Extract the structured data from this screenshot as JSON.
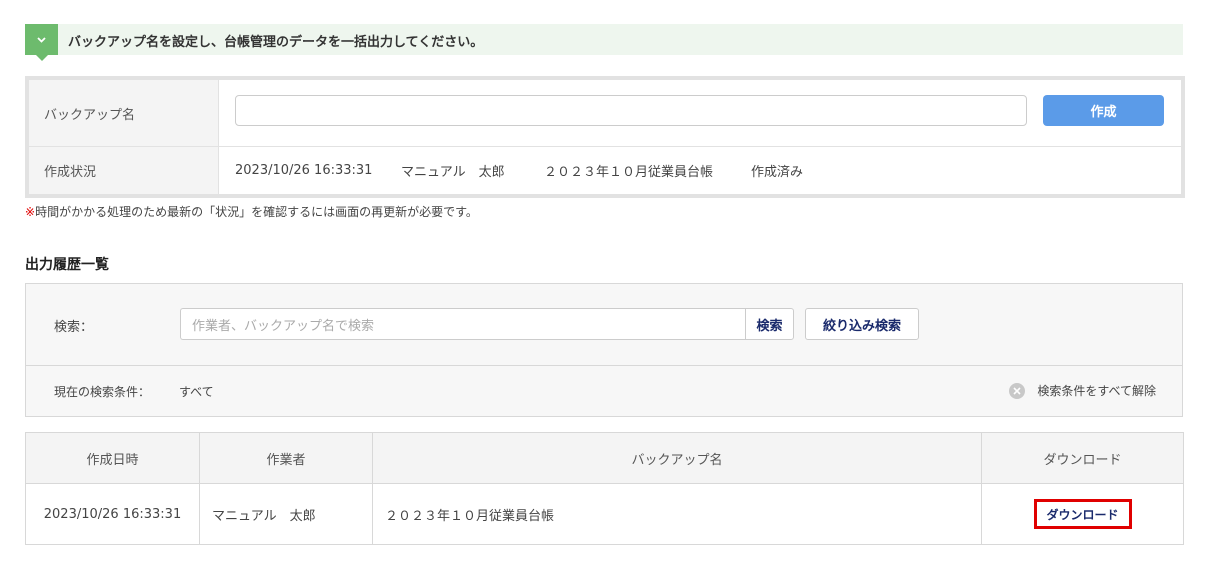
{
  "banner": {
    "text": "バックアップ名を設定し、台帳管理のデータを一括出力してください。",
    "icon": "chevron-down-icon"
  },
  "form": {
    "name_label": "バックアップ名",
    "name_value": "",
    "create_label": "作成",
    "status_label": "作成状況",
    "status": {
      "datetime": "2023/10/26 16:33:31",
      "user": "マニュアル　太郎",
      "backup_name": "２０２３年１０月従業員台帳",
      "state": "作成済み"
    }
  },
  "note": {
    "mark": "※",
    "text": "時間がかかる処理のため最新の「状況」を確認するには画面の再更新が必要です。"
  },
  "history": {
    "title": "出力履歴一覧",
    "search": {
      "label": "検索：",
      "placeholder": "作業者、バックアップ名で検索",
      "search_button": "検索",
      "filter_button": "絞り込み検索",
      "condition_label": "現在の検索条件：",
      "condition_value": "すべて",
      "clear_label": "検索条件をすべて解除"
    },
    "table": {
      "headers": [
        "作成日時",
        "作業者",
        "バックアップ名",
        "ダウンロード"
      ],
      "rows": [
        {
          "datetime": "2023/10/26 16:33:31",
          "user": "マニュアル　太郎",
          "backup_name": "２０２３年１０月従業員台帳",
          "download": "ダウンロード"
        }
      ]
    }
  },
  "colors": {
    "accent_green": "#6dbb6d",
    "primary_blue": "#5b9be8",
    "highlight_red": "#e00000"
  }
}
